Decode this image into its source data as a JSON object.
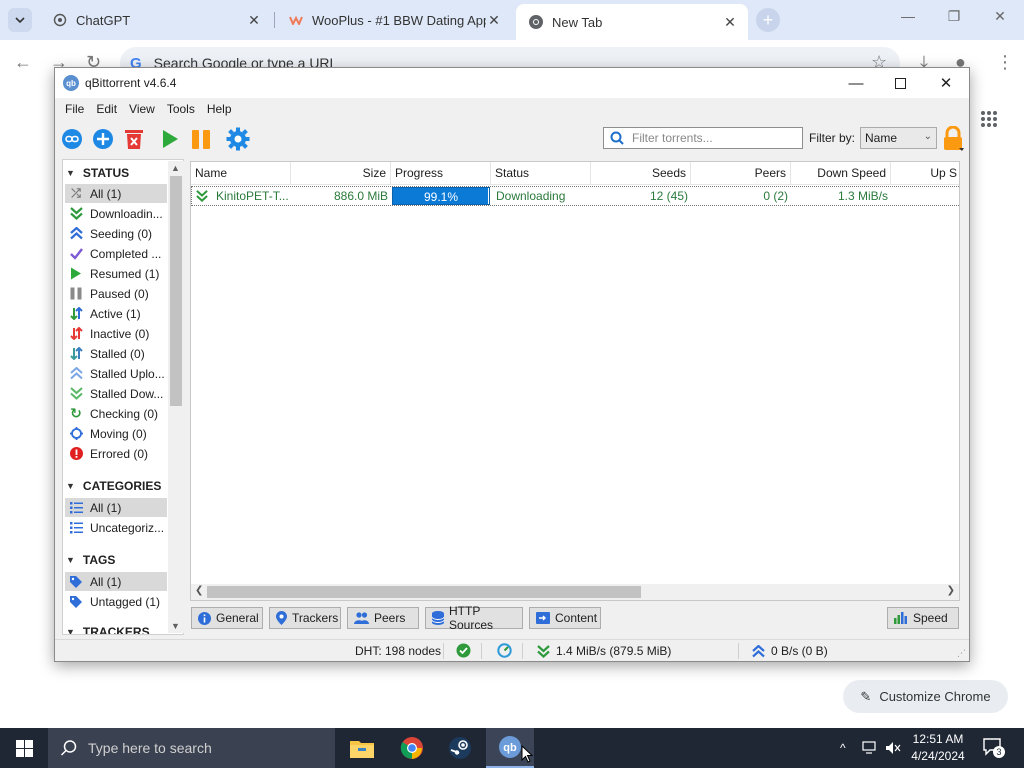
{
  "browser": {
    "tabs": [
      {
        "title": "ChatGPT"
      },
      {
        "title": "WooPlus - #1 BBW Dating App"
      },
      {
        "title": "New Tab"
      }
    ],
    "omnibox_placeholder": "Search Google or type a URL",
    "customize_label": "Customize Chrome"
  },
  "window": {
    "title": "qBittorrent v4.6.4"
  },
  "menu": [
    "File",
    "Edit",
    "View",
    "Tools",
    "Help"
  ],
  "filter": {
    "placeholder": "Filter torrents...",
    "label": "Filter by:",
    "selected": "Name"
  },
  "sidebar": {
    "status_header": "STATUS",
    "status_items": [
      {
        "label": "All (1)",
        "icon": "all-status-icon"
      },
      {
        "label": "Downloadin...",
        "icon": "downloading-icon"
      },
      {
        "label": "Seeding (0)",
        "icon": "seeding-icon"
      },
      {
        "label": "Completed ...",
        "icon": "completed-icon"
      },
      {
        "label": "Resumed (1)",
        "icon": "resumed-icon"
      },
      {
        "label": "Paused (0)",
        "icon": "paused-icon"
      },
      {
        "label": "Active (1)",
        "icon": "active-icon"
      },
      {
        "label": "Inactive (0)",
        "icon": "inactive-icon"
      },
      {
        "label": "Stalled (0)",
        "icon": "stalled-icon"
      },
      {
        "label": "Stalled Uplo...",
        "icon": "stalled-upload-icon"
      },
      {
        "label": "Stalled Dow...",
        "icon": "stalled-download-icon"
      },
      {
        "label": "Checking (0)",
        "icon": "checking-icon"
      },
      {
        "label": "Moving (0)",
        "icon": "moving-icon"
      },
      {
        "label": "Errored (0)",
        "icon": "errored-icon"
      }
    ],
    "categories_header": "CATEGORIES",
    "categories_items": [
      {
        "label": "All (1)"
      },
      {
        "label": "Uncategoriz..."
      }
    ],
    "tags_header": "TAGS",
    "tags_items": [
      {
        "label": "All (1)"
      },
      {
        "label": "Untagged (1)"
      }
    ],
    "trackers_header": "TRACKERS"
  },
  "table": {
    "columns": [
      "Name",
      "Size",
      "Progress",
      "Status",
      "Seeds",
      "Peers",
      "Down Speed",
      "Up S"
    ],
    "rows": [
      {
        "name": "KinitoPET-T...",
        "size": "886.0 MiB",
        "progress": "99.1%",
        "progress_value": 0.991,
        "status": "Downloading",
        "seeds": "12 (45)",
        "peers": "0 (2)",
        "down_speed": "1.3 MiB/s"
      }
    ]
  },
  "bottom_tabs": [
    "General",
    "Trackers",
    "Peers",
    "HTTP Sources",
    "Content"
  ],
  "speed_button": "Speed",
  "statusbar": {
    "dht": "DHT: 198 nodes",
    "download": "1.4 MiB/s (879.5 MiB)",
    "upload": "0 B/s (0 B)"
  },
  "taskbar": {
    "search_placeholder": "Type here to search",
    "time": "12:51 AM",
    "date": "4/24/2024",
    "notification_count": "3"
  },
  "colors": {
    "progress_fill": "#0a7ad6",
    "status_text": "#2a7a3c",
    "accent_blue": "#1a73e8"
  }
}
